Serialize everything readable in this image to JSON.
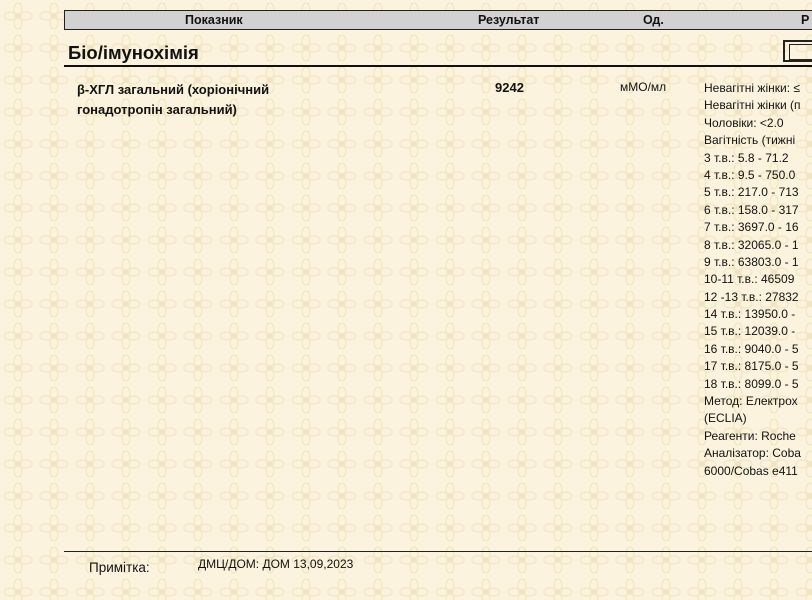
{
  "table_header": {
    "indicator": "Показник",
    "result": "Результат",
    "unit": "Од.",
    "reference": "Р"
  },
  "section": {
    "title": "Біо/імунохімія"
  },
  "test": {
    "name_line1": "β-ХГЛ загальний (хоріонічний",
    "name_line2": "гонадотропін загальний)",
    "result": "9242",
    "unit": "мМО/мл",
    "reference_lines": [
      "Невагітні жінки: ≤",
      "Невагітні жінки (п",
      "Чоловіки: <2.0",
      "Вагітність (тижні",
      "3 т.в.: 5.8 - 71.2",
      "4 т.в.: 9.5 - 750.0",
      "5 т.в.: 217.0 - 713",
      "6 т.в.: 158.0 - 317",
      "7 т.в.: 3697.0 - 16",
      "8 т.в.: 32065.0 - 1",
      "9 т.в.: 63803.0 - 1",
      "10-11 т.в.: 46509",
      "12 -13 т.в.: 27832",
      "14 т.в.: 13950.0 -",
      "15 т.в.: 12039.0 -",
      "16 т.в.: 9040.0 - 5",
      "17 т.в.: 8175.0 - 5",
      "18 т.в.: 8099.0 - 5",
      "Метод: Електрох",
      "(ECLIA)",
      "Реагенти: Roche",
      "Аналізатор: Coba",
      "6000/Cobas e411"
    ]
  },
  "note": {
    "label": "Примітка:",
    "value": "ДМЦ/ДОМ: ДОМ 13,09,2023"
  }
}
